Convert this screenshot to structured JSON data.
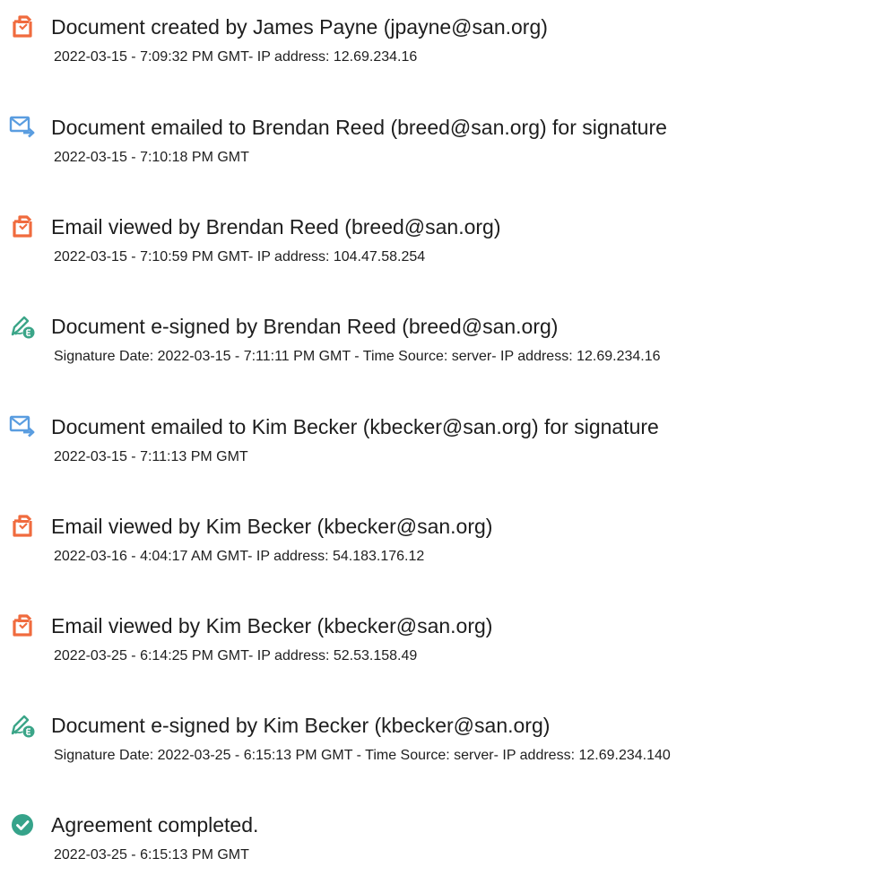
{
  "events": [
    {
      "icon": "document-icon",
      "title": "Document created by James Payne (jpayne@san.org)",
      "detail": "2022-03-15 - 7:09:32 PM GMT- IP address: 12.69.234.16"
    },
    {
      "icon": "email-sent-icon",
      "title": "Document emailed to Brendan Reed (breed@san.org) for signature",
      "detail": "2022-03-15 - 7:10:18 PM GMT"
    },
    {
      "icon": "document-icon",
      "title": "Email viewed by Brendan Reed (breed@san.org)",
      "detail": "2022-03-15 - 7:10:59 PM GMT- IP address: 104.47.58.254"
    },
    {
      "icon": "e-sign-icon",
      "title": "Document e-signed by Brendan Reed (breed@san.org)",
      "detail": "Signature Date: 2022-03-15 - 7:11:11 PM GMT - Time Source: server- IP address: 12.69.234.16"
    },
    {
      "icon": "email-sent-icon",
      "title": "Document emailed to Kim Becker (kbecker@san.org) for signature",
      "detail": "2022-03-15 - 7:11:13 PM GMT"
    },
    {
      "icon": "document-icon",
      "title": "Email viewed by Kim Becker (kbecker@san.org)",
      "detail": "2022-03-16 - 4:04:17 AM GMT- IP address: 54.183.176.12"
    },
    {
      "icon": "document-icon",
      "title": "Email viewed by Kim Becker (kbecker@san.org)",
      "detail": "2022-03-25 - 6:14:25 PM GMT- IP address: 52.53.158.49"
    },
    {
      "icon": "e-sign-icon",
      "title": "Document e-signed by Kim Becker (kbecker@san.org)",
      "detail": "Signature Date: 2022-03-25 - 6:15:13 PM GMT - Time Source: server- IP address: 12.69.234.140"
    },
    {
      "icon": "check-circle-icon",
      "title": "Agreement completed.",
      "detail": "2022-03-25 - 6:15:13 PM GMT"
    }
  ],
  "colors": {
    "document_icon": "#f06b3e",
    "email_icon": "#5a9de0",
    "sign_icon": "#3ba588",
    "check_icon": "#36a38a"
  }
}
